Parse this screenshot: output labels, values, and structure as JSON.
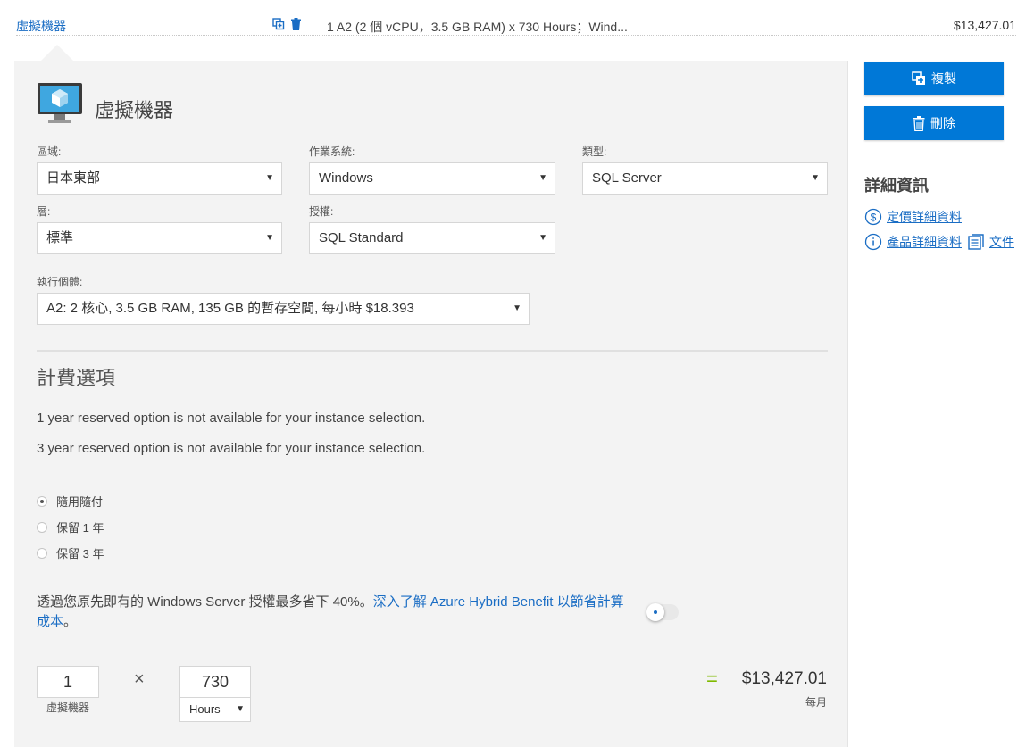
{
  "header": {
    "title": "虛擬機器",
    "description": "1 A2 (2 個 vCPU，3.5 GB RAM) x 730 Hours；Wind...",
    "price": "$13,427.01"
  },
  "panel": {
    "title": "虛擬機器",
    "fields": {
      "region": {
        "label": "區域:",
        "value": "日本東部"
      },
      "os": {
        "label": "作業系統:",
        "value": "Windows"
      },
      "type": {
        "label": "類型:",
        "value": "SQL Server"
      },
      "tier": {
        "label": "層:",
        "value": "標準"
      },
      "license": {
        "label": "授權:",
        "value": "SQL Standard"
      },
      "instance": {
        "label": "執行個體:",
        "value": "A2: 2 核心, 3.5 GB RAM, 135 GB 的暫存空間, 每小時 $18.393"
      }
    },
    "billing": {
      "title": "計費選項",
      "note1": "1 year reserved option is not available for your instance selection.",
      "note2": "3 year reserved option is not available for your instance selection.",
      "options": [
        {
          "label": "隨用隨付",
          "selected": true
        },
        {
          "label": "保留 1 年",
          "selected": false
        },
        {
          "label": "保留 3 年",
          "selected": false
        }
      ]
    },
    "hybrid": {
      "text": "透過您原先即有的 Windows Server 授權最多省下 40%。",
      "link": "深入了解 Azure Hybrid Benefit 以節省計算成本",
      "suffix": "。",
      "toggle_on": false
    },
    "calc": {
      "quantity": "1",
      "quantity_label": "虛擬機器",
      "times": "×",
      "hours": "730",
      "hours_unit": "Hours",
      "equals": "=",
      "total": "$13,427.01",
      "period": "每月"
    }
  },
  "sidebar": {
    "duplicate_label": "複製",
    "delete_label": "刪除",
    "details_title": "詳細資訊",
    "pricing_link": "定價詳細資料",
    "product_link": "產品詳細資料",
    "docs_link": "文件"
  },
  "colors": {
    "accent": "#0078d7",
    "link": "#1a6dc4",
    "equals": "#7fba00",
    "panel_bg": "#f3f3f3"
  },
  "icons": [
    "duplicate-icon",
    "delete-icon",
    "vm-monitor-icon",
    "dollar-icon",
    "info-icon",
    "document-icon"
  ]
}
